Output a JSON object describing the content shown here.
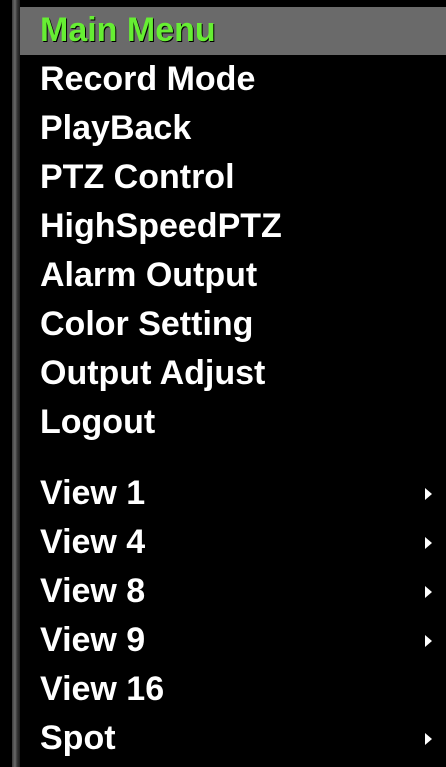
{
  "menu": {
    "title": "Main Menu",
    "items": [
      {
        "label": "Record Mode"
      },
      {
        "label": "PlayBack"
      },
      {
        "label": "PTZ Control"
      },
      {
        "label": "HighSpeedPTZ"
      },
      {
        "label": "Alarm Output"
      },
      {
        "label": "Color Setting"
      },
      {
        "label": "Output Adjust"
      },
      {
        "label": "Logout"
      }
    ],
    "views": [
      {
        "label": "View 1",
        "submenu_icon": "chevron-right-icon"
      },
      {
        "label": "View 4",
        "submenu_icon": "chevron-right-icon"
      },
      {
        "label": "View 8",
        "submenu_icon": "chevron-right-icon"
      },
      {
        "label": "View 9",
        "submenu_icon": "chevron-right-icon"
      },
      {
        "label": "View 16"
      },
      {
        "label": "Spot",
        "submenu_icon": "chevron-right-icon"
      }
    ]
  },
  "colors": {
    "active_text": "#66ee33",
    "active_background": "#6a6a6a",
    "text": "#ffffff",
    "background": "#000000"
  }
}
